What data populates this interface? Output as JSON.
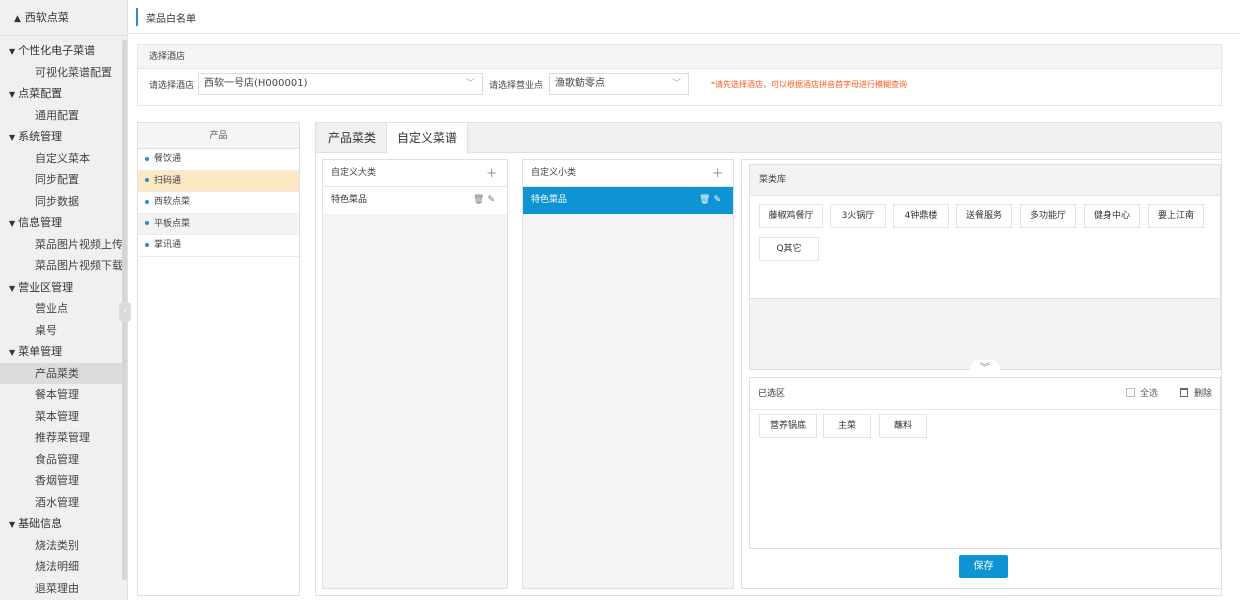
{
  "sidebar": {
    "brand": "西软点菜",
    "groups": [
      {
        "label": "个性化电子菜谱",
        "items": [
          "可视化菜谱配置"
        ]
      },
      {
        "label": "点菜配置",
        "items": [
          "通用配置"
        ]
      },
      {
        "label": "系统管理",
        "items": [
          "自定义菜本",
          "同步配置",
          "同步数据"
        ]
      },
      {
        "label": "信息管理",
        "items": [
          "菜品图片视频上传",
          "菜品图片视频下载"
        ]
      },
      {
        "label": "营业区管理",
        "items": [
          "营业点",
          "桌号"
        ]
      },
      {
        "label": "菜单管理",
        "items": [
          "产品菜类",
          "餐本管理",
          "菜本管理",
          "推荐菜管理",
          "食品管理",
          "香烟管理",
          "酒水管理"
        ]
      },
      {
        "label": "基础信息",
        "items": [
          "烧法类别",
          "烧法明细",
          "退菜理由"
        ]
      }
    ]
  },
  "topbar": {
    "title": "菜品白名单"
  },
  "hotel": {
    "header": "选择酒店",
    "hotel_label": "请选择酒店",
    "hotel_value": "西软一号店(H000001)",
    "outlet_label": "请选择营业点",
    "outlet_value": "渔歌鲂零点",
    "hint": "*请先选择酒店，可以根据酒店拼音首字母进行模糊查询"
  },
  "product": {
    "header": "产品",
    "items": [
      "餐饮通",
      "扫码通",
      "西软点菜",
      "平板点菜",
      "掌讯通"
    ]
  },
  "tabs": [
    "产品菜类",
    "自定义菜谱"
  ],
  "big_category": {
    "header": "自定义大类",
    "rows": [
      "特色菜品"
    ]
  },
  "small_category": {
    "header": "自定义小类",
    "rows": [
      "特色菜品"
    ]
  },
  "library": {
    "header": "菜类库",
    "chips": [
      "藤椒鸡餐厅",
      "3火锅厅",
      "4钟鼎楼",
      "送餐服务",
      "多功能厅",
      "健身中心",
      "要上江南",
      "Q其它"
    ]
  },
  "chosen": {
    "header": "已选区",
    "select_all": "全选",
    "delete": "删除",
    "chips": [
      "营养锅底",
      "主菜",
      "蘸料"
    ]
  },
  "save_label": "保存",
  "colors": {
    "accent": "#0e94d3",
    "hint": "#ff5a1e",
    "selected": "#fde8c4"
  }
}
